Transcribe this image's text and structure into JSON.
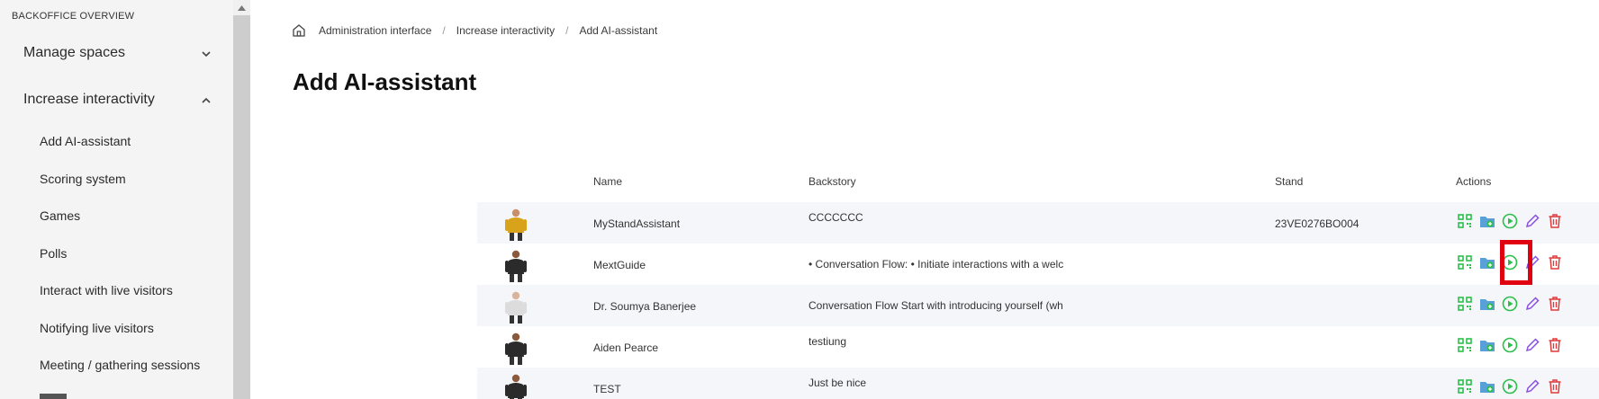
{
  "sidebar": {
    "heading": "BACKOFFICE OVERVIEW",
    "groups": [
      {
        "label": "Manage spaces",
        "expanded": false
      },
      {
        "label": "Increase interactivity",
        "expanded": true
      }
    ],
    "items": [
      {
        "label": "Add AI-assistant"
      },
      {
        "label": "Scoring system"
      },
      {
        "label": "Games"
      },
      {
        "label": "Polls"
      },
      {
        "label": "Interact with live visitors"
      },
      {
        "label": "Notifying live visitors"
      },
      {
        "label": "Meeting / gathering sessions"
      }
    ]
  },
  "breadcrumb": {
    "items": [
      "Administration interface",
      "Increase interactivity",
      "Add AI-assistant"
    ]
  },
  "page": {
    "title": "Add AI-assistant"
  },
  "table": {
    "columns": {
      "name": "Name",
      "backstory": "Backstory",
      "stand": "Stand",
      "actions": "Actions"
    },
    "rows": [
      {
        "name": "MyStandAssistant",
        "backstory": "CCCCCCC",
        "stand": "23VE0276BO004",
        "avatar_color": "#d9a21b"
      },
      {
        "name": "MextGuide",
        "backstory": "• Conversation Flow: • Initiate interactions with a welc",
        "stand": "",
        "avatar_color": "#2b2b2b"
      },
      {
        "name": "Dr. Soumya Banerjee",
        "backstory": "Conversation Flow Start with introducing yourself (wh",
        "stand": "",
        "avatar_color": "#dcdcdc"
      },
      {
        "name": "Aiden Pearce",
        "backstory": "testiung",
        "stand": "",
        "avatar_color": "#2b2b2b"
      },
      {
        "name": "TEST",
        "backstory": "Just be nice",
        "stand": "",
        "avatar_color": "#2b2b2b"
      }
    ]
  },
  "icons": {
    "qr": "qr-code-icon",
    "folder": "folder-add-icon",
    "play": "play-icon",
    "edit": "pencil-icon",
    "delete": "trash-icon"
  },
  "colors": {
    "green": "#2bbf4a",
    "folder": "#5aa0d8",
    "purple": "#8a4fe0",
    "red": "#e03a3a",
    "highlight": "#e00010"
  }
}
